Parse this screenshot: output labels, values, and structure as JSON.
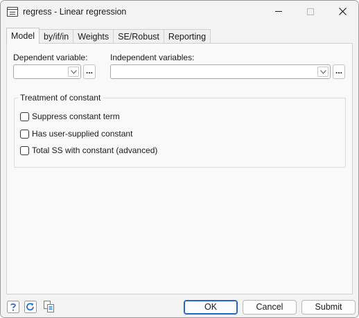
{
  "window": {
    "title": "regress - Linear regression"
  },
  "tabs": [
    {
      "label": "Model",
      "active": true
    },
    {
      "label": "by/if/in",
      "active": false
    },
    {
      "label": "Weights",
      "active": false
    },
    {
      "label": "SE/Robust",
      "active": false
    },
    {
      "label": "Reporting",
      "active": false
    }
  ],
  "model": {
    "dependent_label": "Dependent variable:",
    "dependent_value": "",
    "independent_label": "Independent variables:",
    "independent_value": "",
    "browse_label": "...",
    "constant_group": {
      "title": "Treatment of constant",
      "options": [
        {
          "label": "Suppress constant term",
          "checked": false
        },
        {
          "label": "Has user-supplied constant",
          "checked": false
        },
        {
          "label": "Total SS with constant (advanced)",
          "checked": false
        }
      ]
    }
  },
  "footer": {
    "help_icon": "help-icon",
    "reset_icon": "reset-icon",
    "copy_icon": "copy-command-icon",
    "ok_label": "OK",
    "cancel_label": "Cancel",
    "submit_label": "Submit"
  },
  "colors": {
    "accent": "#1f66c7",
    "icon_blue": "#2a6fc9"
  }
}
